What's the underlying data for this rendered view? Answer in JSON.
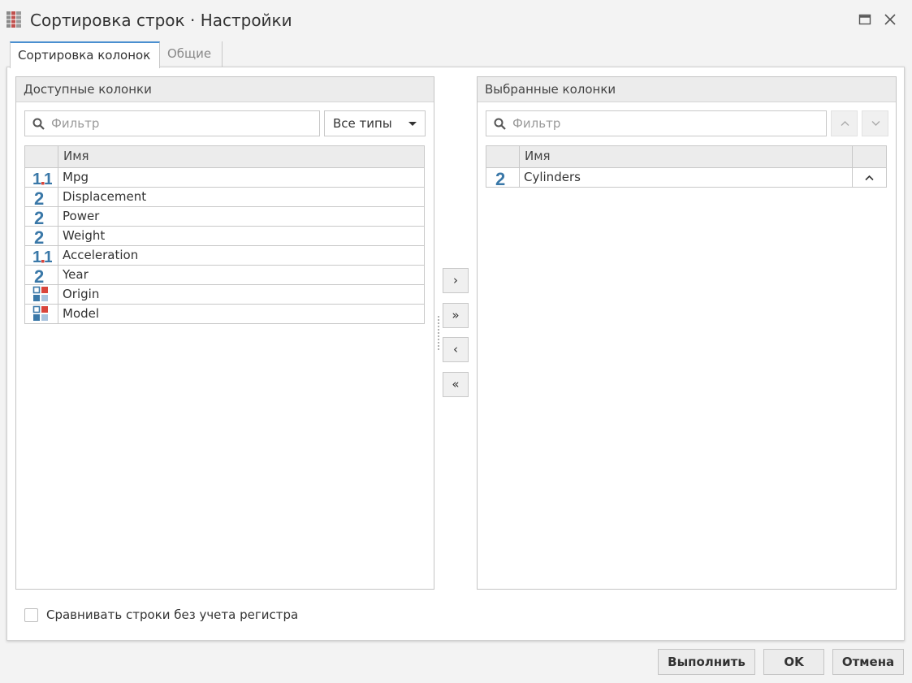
{
  "window": {
    "title": "Сортировка строк · Настройки",
    "maximize_icon": "window-maximize-icon",
    "close_icon": "close-icon"
  },
  "tabs": [
    {
      "label": "Сортировка колонок",
      "active": true
    },
    {
      "label": "Общие",
      "active": false
    }
  ],
  "available": {
    "header": "Доступные колонки",
    "search": {
      "placeholder": "Фильтр",
      "value": ""
    },
    "type_filter": {
      "selected": "Все типы"
    },
    "grid": {
      "name_header": "Имя",
      "rows": [
        {
          "name": "Mpg",
          "type": "double"
        },
        {
          "name": "Displacement",
          "type": "integer"
        },
        {
          "name": "Power",
          "type": "integer"
        },
        {
          "name": "Weight",
          "type": "integer"
        },
        {
          "name": "Acceleration",
          "type": "double"
        },
        {
          "name": "Year",
          "type": "integer"
        },
        {
          "name": "Origin",
          "type": "categorical"
        },
        {
          "name": "Model",
          "type": "categorical"
        }
      ]
    }
  },
  "transfer": {
    "move_right": "›",
    "move_all_right": "»",
    "move_left": "‹",
    "move_all_left": "«"
  },
  "selected": {
    "header": "Выбранные колонки",
    "search": {
      "placeholder": "Фильтр",
      "value": ""
    },
    "grid": {
      "name_header": "Имя",
      "rows": [
        {
          "name": "Cylinders",
          "type": "integer",
          "direction": "ascending"
        }
      ]
    }
  },
  "options": {
    "case_insensitive_label": "Сравнивать строки без учета регистра",
    "case_insensitive_checked": false
  },
  "buttons": {
    "run": "Выполнить",
    "ok": "OK",
    "cancel": "Отмена"
  },
  "colors": {
    "type_icon_blue": "#3a78a8",
    "type_icon_red": "#d9453b",
    "tab_accent": "#4a8fd0"
  }
}
